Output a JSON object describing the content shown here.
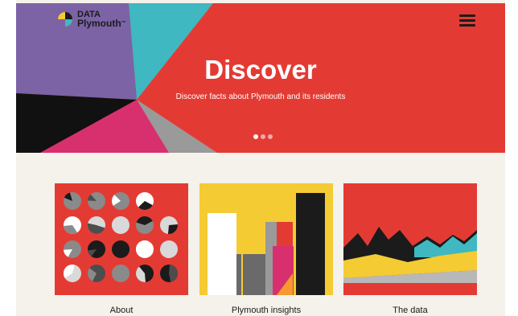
{
  "brand": {
    "line1": "DATA",
    "line2": "Plymouth",
    "tm": "™"
  },
  "hero": {
    "title": "Discover",
    "subtitle": "Discover facts about Plymouth and its residents",
    "slides": 3,
    "active_slide": 1
  },
  "cards": [
    {
      "label": "About"
    },
    {
      "label": "Plymouth insights"
    },
    {
      "label": "The data"
    }
  ],
  "colors": {
    "red": "#e33b34",
    "purple": "#7b63a6",
    "teal": "#3fb8c1",
    "magenta": "#d8306f",
    "yellow": "#f4cb33",
    "black": "#1b1b1b",
    "cream": "#f4f2ea"
  },
  "icons": {
    "logo": "data-plymouth-logo",
    "menu": "hamburger-menu-icon"
  }
}
